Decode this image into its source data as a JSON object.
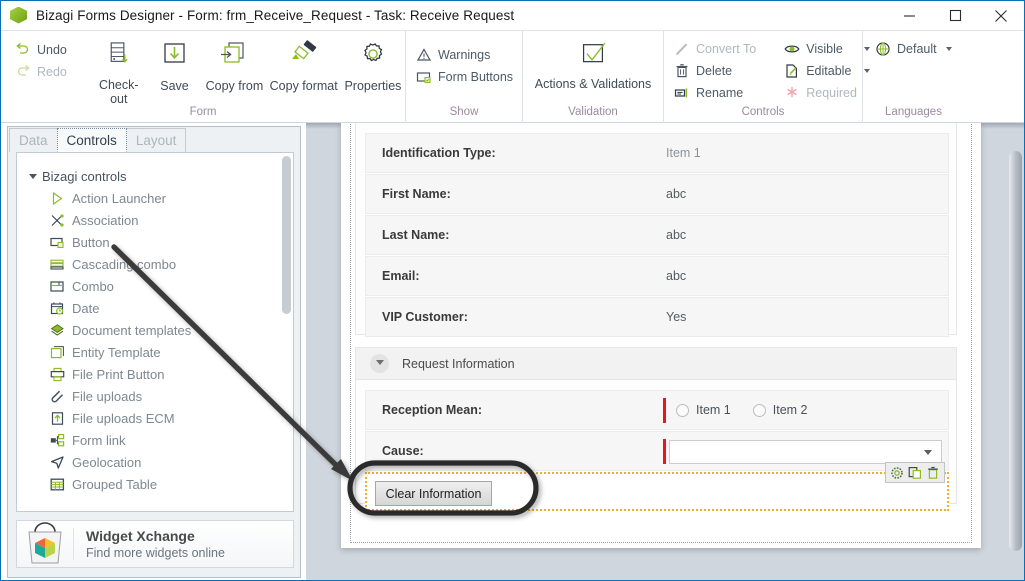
{
  "window": {
    "title": "Bizagi Forms Designer  - Form: frm_Receive_Request - Task:  Receive Request",
    "app_icon": "bizagi-cube-icon",
    "minimize": "minimize-icon",
    "maximize": "maximize-icon",
    "close": "close-icon"
  },
  "ribbon": {
    "groups": [
      {
        "title": "Form",
        "small": [
          {
            "label": "Undo",
            "icon": "undo-icon",
            "enabled": true
          },
          {
            "label": "Redo",
            "icon": "redo-icon",
            "enabled": false
          }
        ],
        "big": [
          {
            "label": "Check-out",
            "icon": "check-out-icon"
          },
          {
            "label": "Save",
            "icon": "save-icon"
          },
          {
            "label": "Copy from",
            "icon": "copy-from-icon"
          },
          {
            "label": "Copy format",
            "icon": "copy-format-icon"
          },
          {
            "label": "Properties",
            "icon": "properties-gear-icon"
          }
        ]
      },
      {
        "title": "Show",
        "small": [
          {
            "label": "Warnings",
            "icon": "warning-triangle-icon",
            "enabled": true
          },
          {
            "label": "Form Buttons",
            "icon": "form-buttons-icon",
            "enabled": true
          }
        ]
      },
      {
        "title": "Validation",
        "big": [
          {
            "label": "Actions & Validations",
            "icon": "checkmark-box-icon"
          }
        ]
      },
      {
        "title": "Controls",
        "small": [
          {
            "label": "Convert To",
            "icon": "convert-to-icon",
            "enabled": false
          },
          {
            "label": "Delete",
            "icon": "delete-trash-icon",
            "enabled": true
          },
          {
            "label": "Rename",
            "icon": "rename-icon",
            "enabled": true
          }
        ]
      },
      {
        "title": "Controls",
        "small": [
          {
            "label": "Visible",
            "icon": "eye-icon",
            "enabled": true,
            "dropdown": true
          },
          {
            "label": "Editable",
            "icon": "editable-pencil-icon",
            "enabled": true,
            "dropdown": true
          },
          {
            "label": "Required",
            "icon": "required-asterisk-icon",
            "enabled": false
          }
        ]
      },
      {
        "title": "Languages",
        "small": [
          {
            "label": "Default",
            "icon": "globe-icon",
            "enabled": true,
            "dropdown": true
          }
        ]
      }
    ]
  },
  "left_panel": {
    "tabs": [
      {
        "label": "Data",
        "active": false
      },
      {
        "label": "Controls",
        "active": true
      },
      {
        "label": "Layout",
        "active": false
      }
    ],
    "tree_root": {
      "label": "Bizagi controls",
      "expanded": true
    },
    "items": [
      {
        "label": "Action Launcher",
        "icon": "play-triangle-icon"
      },
      {
        "label": "Association",
        "icon": "association-icon"
      },
      {
        "label": "Button",
        "icon": "button-icon"
      },
      {
        "label": "Cascading combo",
        "icon": "cascading-combo-icon"
      },
      {
        "label": "Combo",
        "icon": "combo-icon"
      },
      {
        "label": "Date",
        "icon": "calendar-clock-icon"
      },
      {
        "label": "Document templates",
        "icon": "document-templates-icon"
      },
      {
        "label": "Entity Template",
        "icon": "entity-template-icon"
      },
      {
        "label": "File Print Button",
        "icon": "printer-icon"
      },
      {
        "label": "File uploads",
        "icon": "paperclip-icon"
      },
      {
        "label": "File uploads ECM",
        "icon": "upload-arrow-icon"
      },
      {
        "label": "Form link",
        "icon": "form-link-icon"
      },
      {
        "label": "Geolocation",
        "icon": "geolocation-arrow-icon"
      },
      {
        "label": "Grouped Table",
        "icon": "grouped-table-icon"
      }
    ],
    "widget_promo": {
      "icon": "shopping-bag-icon",
      "title": "Widget Xchange",
      "subtitle": "Find more widgets online"
    }
  },
  "form_canvas": {
    "customer_fields": [
      {
        "label": "Identification Type:",
        "value": "Item 1",
        "type": "combo-preview"
      },
      {
        "label": "First Name:",
        "value": "abc",
        "type": "text"
      },
      {
        "label": "Last Name:",
        "value": "abc",
        "type": "text"
      },
      {
        "label": "Email:",
        "value": "abc",
        "type": "text"
      },
      {
        "label": "VIP Customer:",
        "value": "Yes",
        "type": "boolean"
      }
    ],
    "section": {
      "title": "Request Information",
      "collapse_icon": "chevron-down-icon",
      "reception_mean": {
        "label": "Reception Mean:",
        "required_marker_color": "#e8151c",
        "options": [
          {
            "label": "Item 1",
            "selected": false
          },
          {
            "label": "Item 2",
            "selected": false
          }
        ]
      },
      "cause": {
        "label": "Cause:",
        "value": "",
        "required_marker_color": "#e8151c",
        "dropdown_icon": "chevron-down-icon"
      },
      "selected_control": {
        "button_label": "Clear Information",
        "selection_color": "#ecb128",
        "mini_toolbar": [
          {
            "icon": "gear-icon",
            "name": "properties"
          },
          {
            "icon": "duplicate-icon",
            "name": "duplicate"
          },
          {
            "icon": "trash-icon",
            "name": "delete"
          }
        ]
      }
    }
  },
  "annotations": {
    "arrow": {
      "icon": "arrow-annotation",
      "from_label": "Button",
      "to_label": "Clear Information"
    },
    "highlight_ellipse": {
      "icon": "ellipse-annotation",
      "color": "#2b2b2b"
    }
  }
}
